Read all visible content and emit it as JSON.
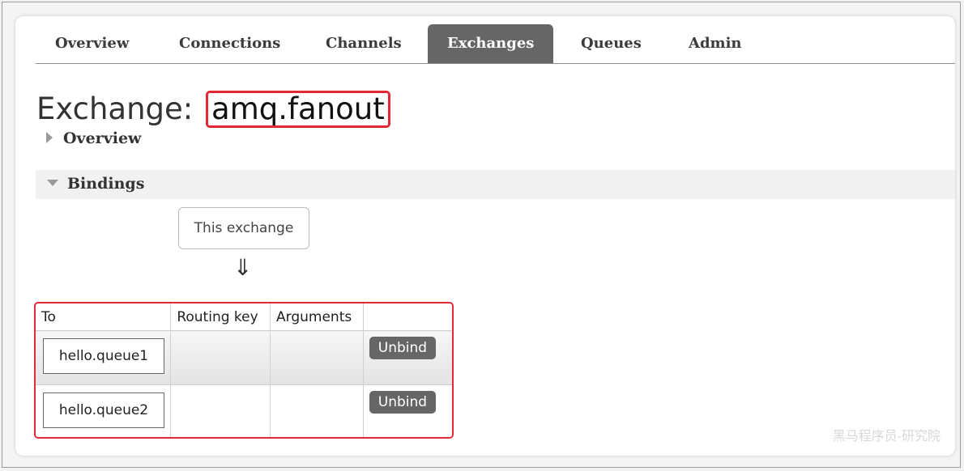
{
  "nav": {
    "tabs": [
      {
        "label": "Overview",
        "active": false
      },
      {
        "label": "Connections",
        "active": false
      },
      {
        "label": "Channels",
        "active": false
      },
      {
        "label": "Exchanges",
        "active": true
      },
      {
        "label": "Queues",
        "active": false
      },
      {
        "label": "Admin",
        "active": false
      }
    ]
  },
  "page": {
    "title_prefix": "Exchange:",
    "exchange_name": "amq.fanout"
  },
  "sections": {
    "overview_label": "Overview",
    "bindings_label": "Bindings"
  },
  "bindings": {
    "source_label": "This exchange",
    "arrow": "⇓",
    "columns": [
      "To",
      "Routing key",
      "Arguments",
      ""
    ],
    "rows": [
      {
        "to": "hello.queue1",
        "routing_key": "",
        "arguments": "",
        "action": "Unbind"
      },
      {
        "to": "hello.queue2",
        "routing_key": "",
        "arguments": "",
        "action": "Unbind"
      }
    ]
  },
  "watermark": "黑马程序员-研究院",
  "colors": {
    "active_tab": "#666666",
    "highlight_border": "#e32836",
    "button_bg": "#666666"
  }
}
